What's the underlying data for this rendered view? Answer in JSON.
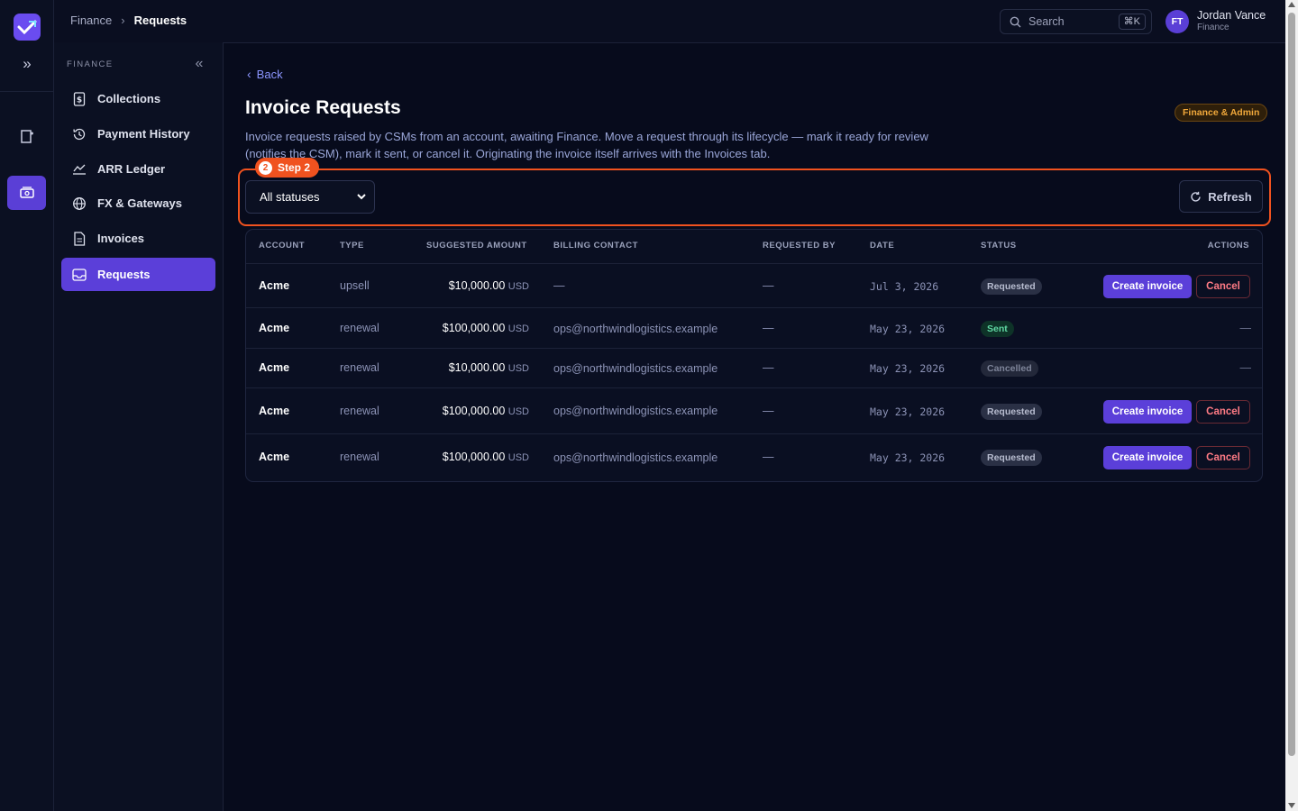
{
  "topbar": {
    "breadcrumb": [
      {
        "label": "Finance"
      },
      {
        "label": "Requests"
      }
    ],
    "search_placeholder": "Search",
    "search_shortcut": "⌘K",
    "user": {
      "initials": "FT",
      "name": "Jordan Vance",
      "role": "Finance"
    }
  },
  "sidebar": {
    "section_label": "FINANCE",
    "items": [
      {
        "label": "Collections",
        "icon": "dollar-doc-icon"
      },
      {
        "label": "Payment History",
        "icon": "history-icon"
      },
      {
        "label": "ARR Ledger",
        "icon": "chart-line-icon"
      },
      {
        "label": "FX & Gateways",
        "icon": "globe-icon"
      },
      {
        "label": "Invoices",
        "icon": "document-icon"
      },
      {
        "label": "Requests",
        "icon": "inbox-icon",
        "active": true
      }
    ]
  },
  "page": {
    "back_label": "Back",
    "title": "Invoice Requests",
    "role_badge": "Finance & Admin",
    "description": "Invoice requests raised by CSMs from an account, awaiting Finance. Move a request through its lifecycle — mark it ready for review (notifies the CSM), mark it sent, or cancel it. Originating the invoice itself arrives with the Invoices tab."
  },
  "tour": {
    "step_number": "2",
    "step_label": "Step 2"
  },
  "filters": {
    "status_selected": "All statuses",
    "refresh_label": "Refresh"
  },
  "table": {
    "columns": [
      "ACCOUNT",
      "TYPE",
      "SUGGESTED AMOUNT",
      "BILLING CONTACT",
      "REQUESTED BY",
      "DATE",
      "STATUS",
      "ACTIONS"
    ],
    "rows": [
      {
        "account": "Acme",
        "type": "upsell",
        "amount": "$10,000.00",
        "currency": "USD",
        "contact": "—",
        "requested_by": "—",
        "date": "Jul 3, 2026",
        "status": "Requested",
        "status_kind": "requested",
        "create_label": "Create invoice",
        "cancel_label": "Cancel"
      },
      {
        "account": "Acme",
        "type": "renewal",
        "amount": "$100,000.00",
        "currency": "USD",
        "contact": "ops@northwindlogistics.example",
        "requested_by": "—",
        "date": "May 23, 2026",
        "status": "Sent",
        "status_kind": "sent",
        "actions_text": "—"
      },
      {
        "account": "Acme",
        "type": "renewal",
        "amount": "$10,000.00",
        "currency": "USD",
        "contact": "ops@northwindlogistics.example",
        "requested_by": "—",
        "date": "May 23, 2026",
        "status": "Cancelled",
        "status_kind": "cancelled",
        "actions_text": "—"
      },
      {
        "account": "Acme",
        "type": "renewal",
        "amount": "$100,000.00",
        "currency": "USD",
        "contact": "ops@northwindlogistics.example",
        "requested_by": "—",
        "date": "May 23, 2026",
        "status": "Requested",
        "status_kind": "requested",
        "create_label": "Create invoice",
        "cancel_label": "Cancel"
      },
      {
        "account": "Acme",
        "type": "renewal",
        "amount": "$100,000.00",
        "currency": "USD",
        "contact": "ops@northwindlogistics.example",
        "requested_by": "—",
        "date": "May 23, 2026",
        "status": "Requested",
        "status_kind": "requested",
        "create_label": "Create invoice",
        "cancel_label": "Cancel"
      }
    ]
  },
  "colors": {
    "accent": "#5b3fd9",
    "tour_highlight": "#f0521f",
    "link": "#8c96ff",
    "badge_text": "#f2a93b"
  }
}
